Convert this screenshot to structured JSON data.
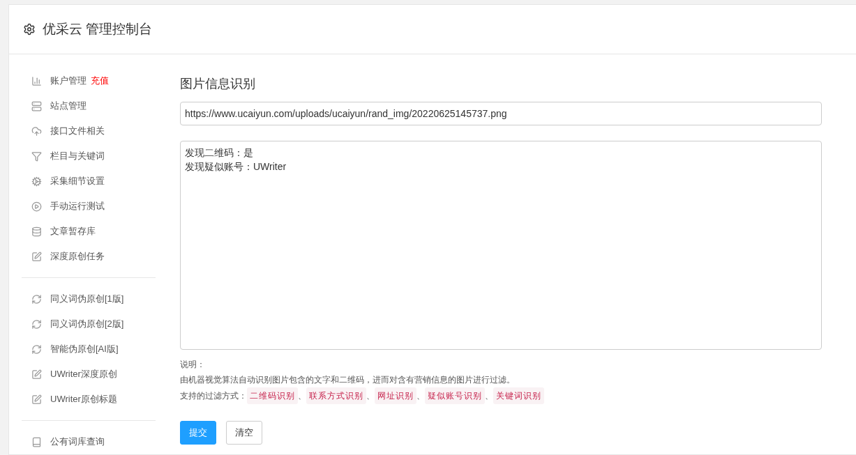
{
  "header": {
    "title": "优采云 管理控制台"
  },
  "sidebar": {
    "groups": [
      {
        "items": [
          {
            "label": "账户管理",
            "badge": "充值"
          },
          {
            "label": "站点管理"
          },
          {
            "label": "接口文件相关"
          },
          {
            "label": "栏目与关键词"
          },
          {
            "label": "采集细节设置"
          },
          {
            "label": "手动运行测试"
          },
          {
            "label": "文章暂存库"
          },
          {
            "label": "深度原创任务"
          }
        ]
      },
      {
        "items": [
          {
            "label": "同义词伪原创[1版]"
          },
          {
            "label": "同义词伪原创[2版]"
          },
          {
            "label": "智能伪原创[AI版]"
          },
          {
            "label": "UWriter深度原创"
          },
          {
            "label": "UWriter原创标题"
          }
        ]
      },
      {
        "items": [
          {
            "label": "公有词库查询"
          }
        ]
      }
    ]
  },
  "main": {
    "title": "图片信息识别",
    "url_field": {
      "value": "https://www.ucaiyun.com/uploads/ucaiyun/rand_img/20220625145737.png"
    },
    "result_lines": [
      "发现二维码：是",
      "发现疑似账号：UWriter"
    ],
    "note_title": "说明：",
    "note_text": "由机器视觉算法自动识别图片包含的文字和二维码，进而对含有营销信息的图片进行过滤。",
    "methods_label": "支持的过滤方式：",
    "methods": [
      "二维码识别",
      "联系方式识别",
      "网址识别",
      "疑似账号识别",
      "关键词识别"
    ],
    "separator": "、",
    "buttons": [
      {
        "label": "提交",
        "kind": "primary"
      },
      {
        "label": "清空",
        "kind": "default"
      }
    ]
  }
}
